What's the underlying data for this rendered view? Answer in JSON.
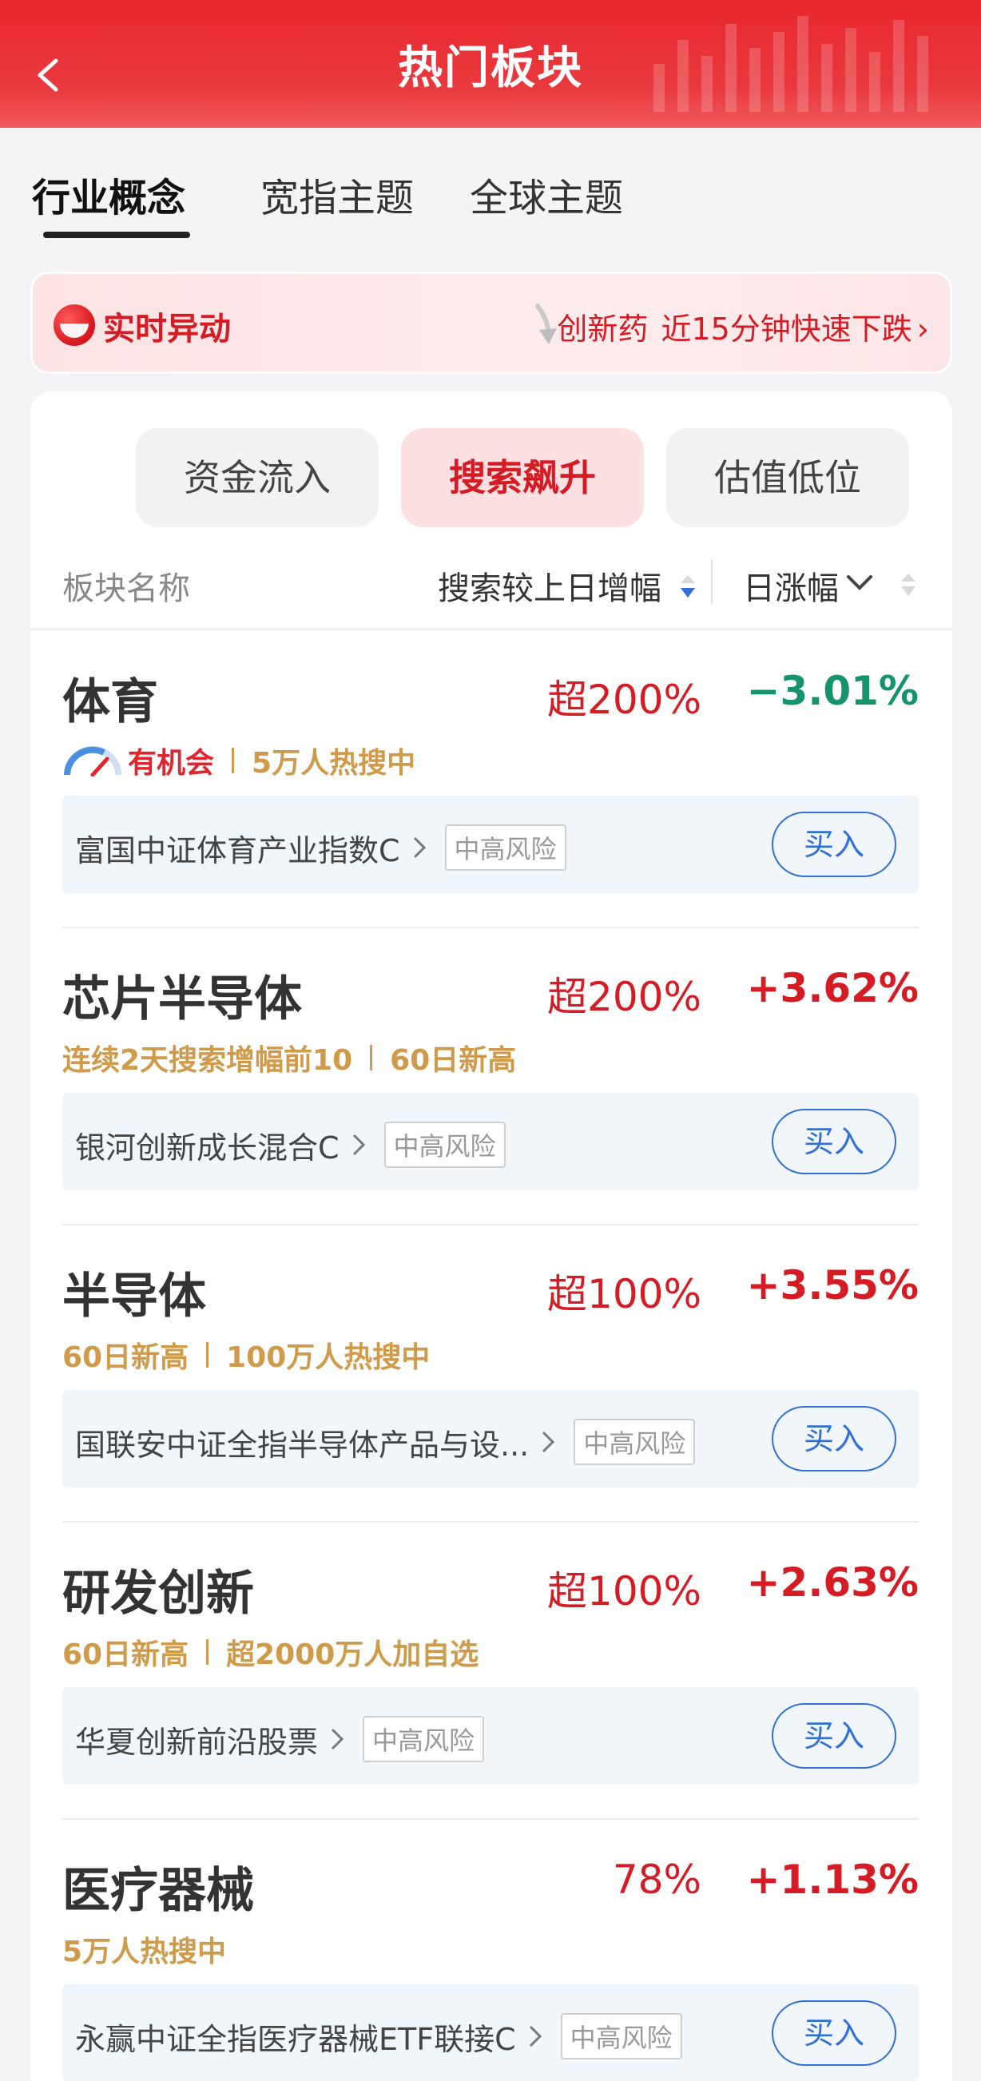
{
  "header": {
    "title": "热门板块"
  },
  "tabs": [
    {
      "label": "行业概念",
      "active": true
    },
    {
      "label": "宽指主题",
      "active": false
    },
    {
      "label": "全球主题",
      "active": false
    }
  ],
  "alert": {
    "tag": "实时异动",
    "sector": "创新药",
    "message": "近15分钟快速下跌",
    "arrow": "›"
  },
  "filters": [
    {
      "label": "资金流入",
      "active": false
    },
    {
      "label": "搜索飙升",
      "active": true
    },
    {
      "label": "估值低位",
      "active": false
    }
  ],
  "columns": {
    "name": "板块名称",
    "search": "搜索较上日增幅",
    "daily": "日涨幅"
  },
  "rows": [
    {
      "name": "体育",
      "search_pct": "超200%",
      "daily_pct": "−3.01%",
      "direction": "down",
      "opportunity": "有机会",
      "tags": [
        "5万人热搜中"
      ],
      "fund": "富国中证体育产业指数C",
      "risk": "中高风险",
      "buy": "买入"
    },
    {
      "name": "芯片半导体",
      "search_pct": "超200%",
      "daily_pct": "+3.62%",
      "direction": "up",
      "tags": [
        "连续2天搜索增幅前10",
        "60日新高"
      ],
      "fund": "银河创新成长混合C",
      "risk": "中高风险",
      "buy": "买入"
    },
    {
      "name": "半导体",
      "search_pct": "超100%",
      "daily_pct": "+3.55%",
      "direction": "up",
      "tags": [
        "60日新高",
        "100万人热搜中"
      ],
      "fund": "国联安中证全指半导体产品与设...",
      "risk": "中高风险",
      "buy": "买入"
    },
    {
      "name": "研发创新",
      "search_pct": "超100%",
      "daily_pct": "+2.63%",
      "direction": "up",
      "tags": [
        "60日新高",
        "超2000万人加自选"
      ],
      "fund": "华夏创新前沿股票",
      "risk": "中高风险",
      "buy": "买入"
    },
    {
      "name": "医疗器械",
      "search_pct": "78%",
      "daily_pct": "+1.13%",
      "direction": "up",
      "tags": [
        "5万人热搜中"
      ],
      "fund": "永赢中证全指医疗器械ETF联接C",
      "risk": "中高风险",
      "buy": "买入"
    }
  ],
  "colors": {
    "brand_red": "#e8262d",
    "up": "#d51b23",
    "down": "#14936c",
    "tag_gold": "#cf9a4a",
    "buy_blue": "#2f6fd6"
  }
}
